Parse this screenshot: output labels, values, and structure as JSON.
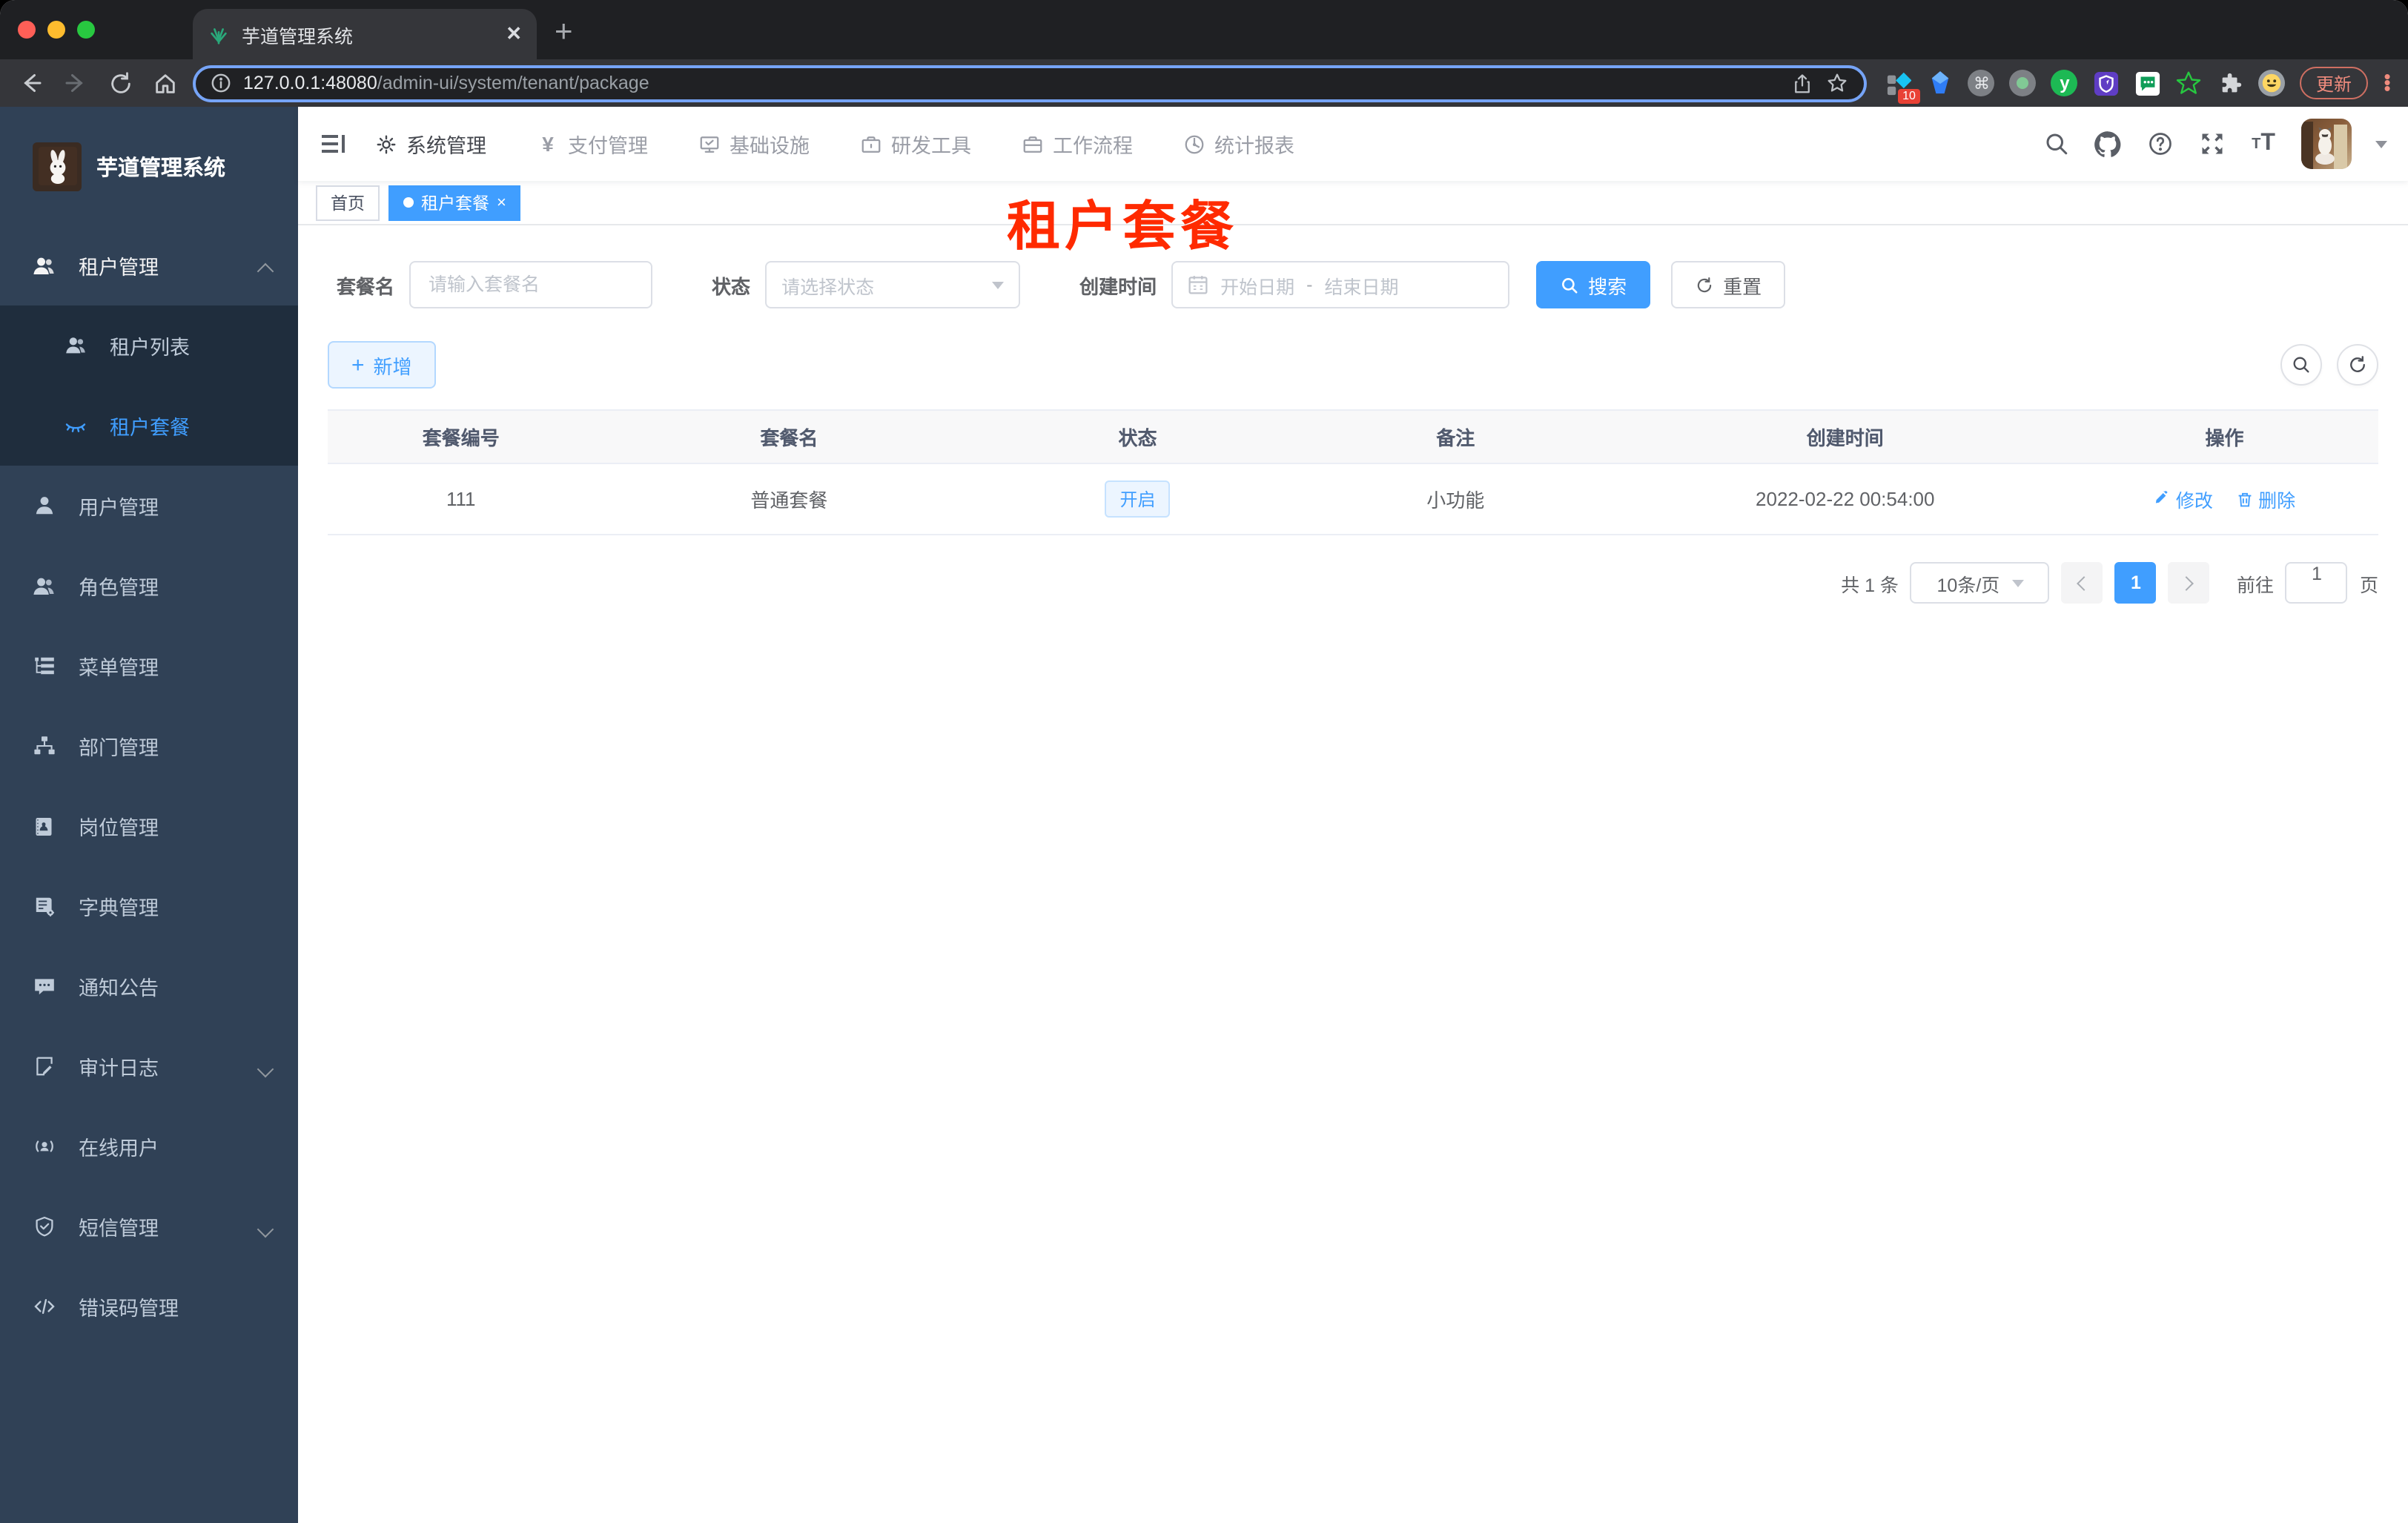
{
  "browser": {
    "tab_title": "芋道管理系统",
    "new_tab": "+",
    "close_tab": "✕",
    "url_host": "127.0.0.1:48080",
    "url_path": "/admin-ui/system/tenant/package",
    "ext_badge": "10",
    "update_label": "更新",
    "kebab": "⋮"
  },
  "sidebar": {
    "app_title": "芋道管理系统",
    "items": [
      {
        "label": "租户管理"
      },
      {
        "label": "租户列表"
      },
      {
        "label": "租户套餐"
      },
      {
        "label": "用户管理"
      },
      {
        "label": "角色管理"
      },
      {
        "label": "菜单管理"
      },
      {
        "label": "部门管理"
      },
      {
        "label": "岗位管理"
      },
      {
        "label": "字典管理"
      },
      {
        "label": "通知公告"
      },
      {
        "label": "审计日志"
      },
      {
        "label": "在线用户"
      },
      {
        "label": "短信管理"
      },
      {
        "label": "错误码管理"
      }
    ]
  },
  "topnav": {
    "items": [
      {
        "label": "系统管理"
      },
      {
        "label": "支付管理"
      },
      {
        "label": "基础设施"
      },
      {
        "label": "研发工具"
      },
      {
        "label": "工作流程"
      },
      {
        "label": "统计报表"
      }
    ]
  },
  "tags": {
    "home": "首页",
    "active": "租户套餐"
  },
  "page": {
    "watermark": "租户套餐"
  },
  "filters": {
    "name_label": "套餐名",
    "name_placeholder": "请输入套餐名",
    "status_label": "状态",
    "status_placeholder": "请选择状态",
    "date_label": "创建时间",
    "date_start_placeholder": "开始日期",
    "date_separator": "-",
    "date_end_placeholder": "结束日期",
    "search_label": "搜索",
    "reset_label": "重置",
    "add_label": "新增"
  },
  "table": {
    "columns": [
      "套餐编号",
      "套餐名",
      "状态",
      "备注",
      "创建时间",
      "操作"
    ],
    "rows": [
      {
        "id": "111",
        "name": "普通套餐",
        "status": "开启",
        "remark": "小功能",
        "created": "2022-02-22 00:54:00",
        "edit": "修改",
        "delete": "删除"
      }
    ]
  },
  "pagination": {
    "total": "共 1 条",
    "page_size": "10条/页",
    "current": "1",
    "goto_label": "前往",
    "goto_value": "1",
    "unit": "页"
  },
  "colors": {
    "accent": "#409eff",
    "sidebar_bg": "#304156",
    "submenu_bg": "#1f2d3d",
    "watermark_red": "#ff2a00",
    "status_tag_bg": "#ecf5ff"
  }
}
